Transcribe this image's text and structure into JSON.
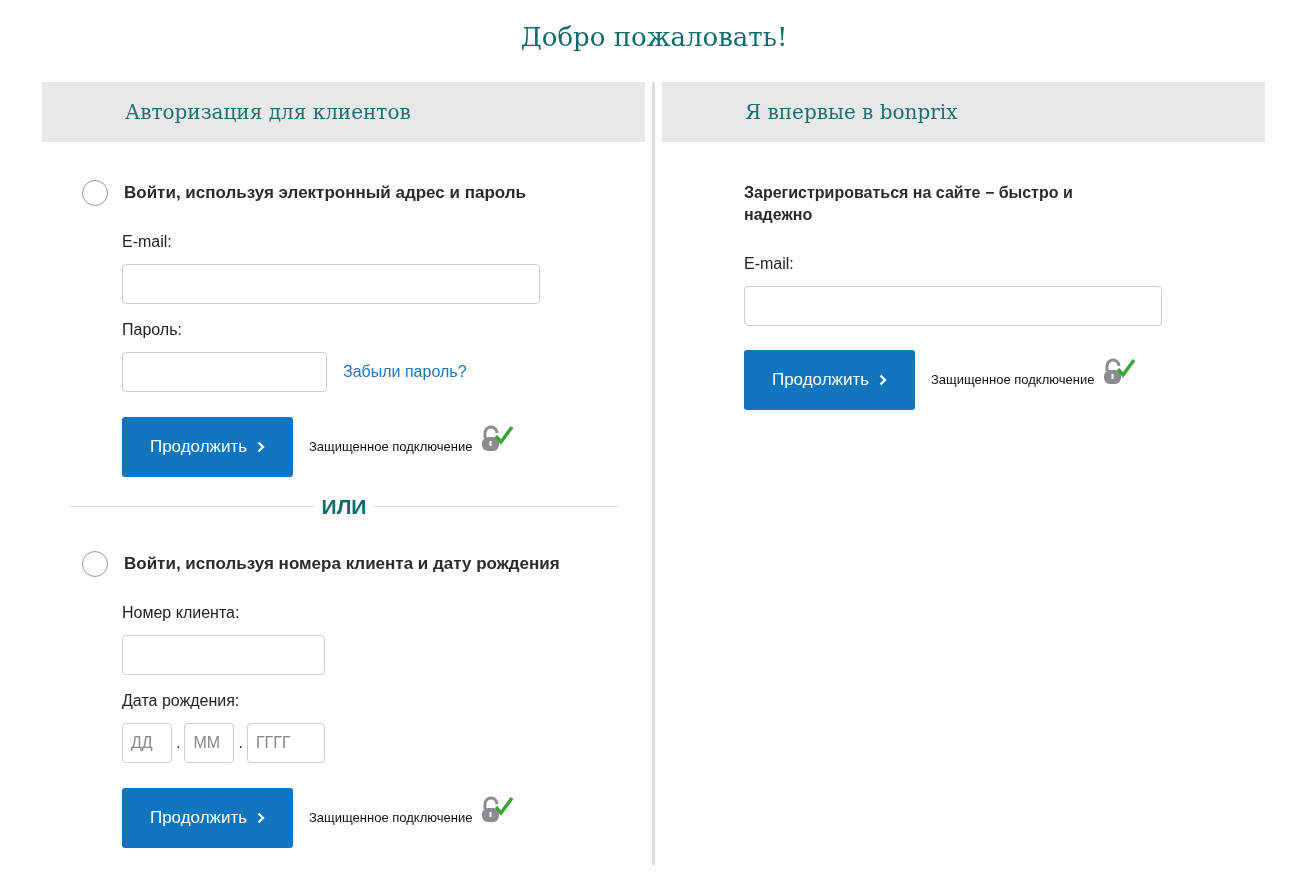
{
  "title": "Добро пожаловать!",
  "login": {
    "heading": "Авторизация для клиентов",
    "options": [
      {
        "label": "Войти, используя электронный адрес и пароль",
        "selected": false,
        "fields": [
          {
            "kind": "email",
            "label": "E-mail:"
          },
          {
            "kind": "password",
            "label": "Пароль:",
            "link": "Забыли пароль?"
          }
        ],
        "button": "Продолжить",
        "secure_note": "Защищенное подключение"
      },
      {
        "label": "Войти, используя номера клиента и дату рождения",
        "selected": false,
        "fields": [
          {
            "kind": "number",
            "label": "Номер клиента:"
          },
          {
            "kind": "date",
            "label": "Дата рождения:",
            "parts": [
              {
                "placeholder": "ДД"
              },
              {
                "placeholder": "ММ"
              },
              {
                "placeholder": "ГГГГ"
              }
            ],
            "separator": "."
          }
        ],
        "button": "Продолжить",
        "secure_note": "Защищенное подключение"
      }
    ],
    "separator": "ИЛИ"
  },
  "register": {
    "heading": "Я впервые в bonprix",
    "intro": "Зарегистрироваться на сайте − быстро и надежно",
    "fields": [
      {
        "kind": "email",
        "label": "E-mail:"
      }
    ],
    "button": "Продолжить",
    "secure_note": "Защищенное подключение"
  }
}
